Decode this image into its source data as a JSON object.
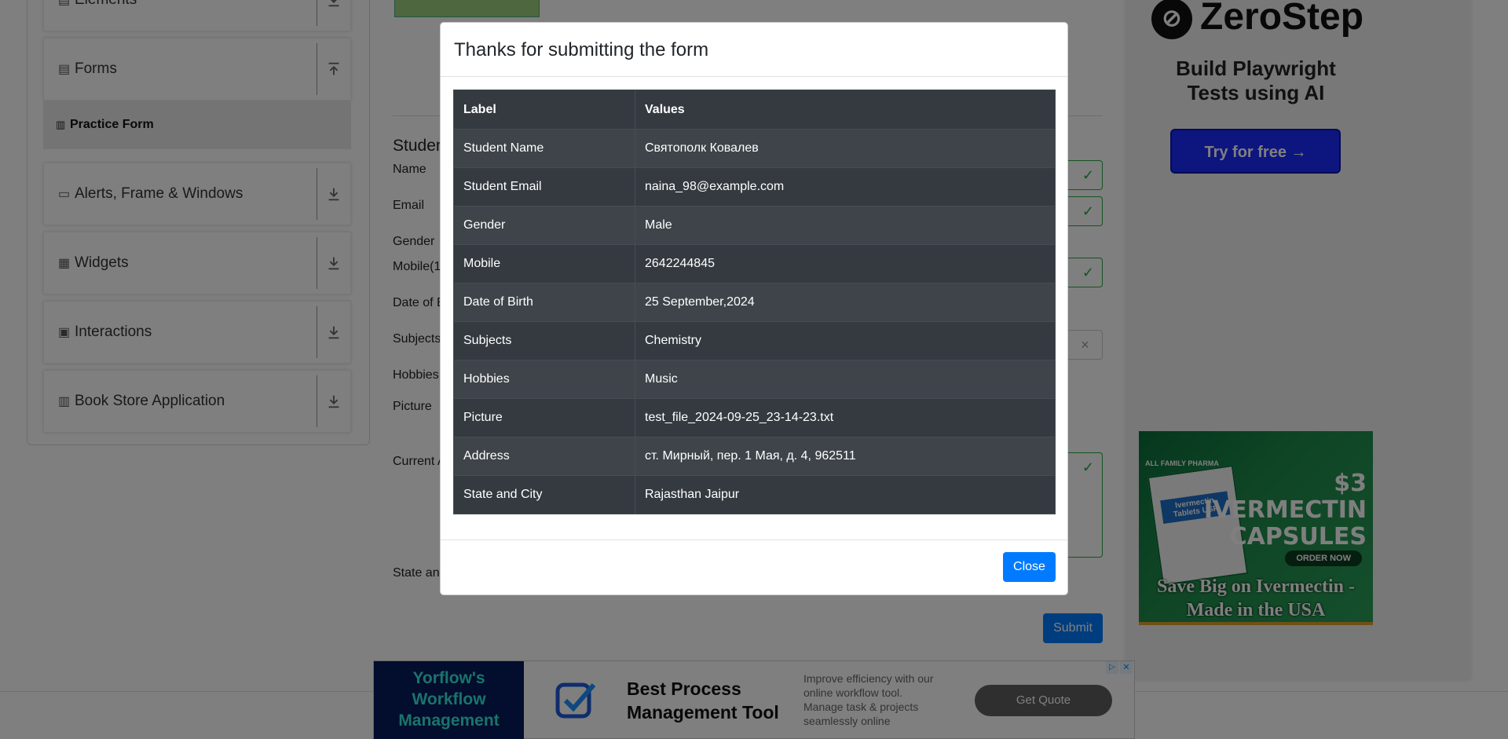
{
  "sidebar": {
    "groups": [
      {
        "label": "Elements",
        "icon": "document-icon"
      },
      {
        "label": "Forms",
        "icon": "form-icon"
      },
      {
        "label": "Alerts, Frame & Windows",
        "icon": "window-icon"
      },
      {
        "label": "Widgets",
        "icon": "widgets-icon"
      },
      {
        "label": "Interactions",
        "icon": "interactions-icon"
      },
      {
        "label": "Book Store Application",
        "icon": "bookstore-icon"
      }
    ],
    "active_item": "Practice Form"
  },
  "form": {
    "title": "Studen",
    "labels": {
      "name": "Name",
      "email": "Email",
      "gender": "Gender",
      "mobile": "Mobile(1",
      "dob": "Date of B",
      "subjects": "Subjects",
      "hobbies": "Hobbies",
      "picture": "Picture",
      "address": "Current A",
      "state": "State an"
    },
    "submit_label": "Submit"
  },
  "ads": {
    "zerostep": {
      "logo_text": "ZeroStep",
      "headline": "Build Playwright Tests using AI",
      "button": "Try for free →"
    },
    "ivermectin": {
      "brand": "ALL FAMILY PHARMA",
      "box_label": "Ivermectin Tablets USP",
      "price": "$3",
      "price_line2": "IVERMECTIN",
      "price_line3": "CAPSULES",
      "order": "ORDER NOW",
      "caption": "Save Big on Ivermectin - Made in the USA"
    },
    "bottom_banner": {
      "left_text": "Yorflow's Workflow Management",
      "title": "Best Process Management Tool",
      "description": "Improve efficiency with our online workflow tool. Manage task & projects seamlessly online",
      "button": "Get Quote",
      "adchoices": "▷",
      "close": "✕"
    }
  },
  "modal": {
    "title": "Thanks for submitting the form",
    "columns": [
      "Label",
      "Values"
    ],
    "rows": [
      {
        "label": "Student Name",
        "value": "Святополк Ковалев"
      },
      {
        "label": "Student Email",
        "value": "naina_98@example.com"
      },
      {
        "label": "Gender",
        "value": "Male"
      },
      {
        "label": "Mobile",
        "value": "2642244845"
      },
      {
        "label": "Date of Birth",
        "value": "25 September,2024"
      },
      {
        "label": "Subjects",
        "value": "Chemistry"
      },
      {
        "label": "Hobbies",
        "value": "Music"
      },
      {
        "label": "Picture",
        "value": "test_file_2024-09-25_23-14-23.txt"
      },
      {
        "label": "Address",
        "value": "ст. Мирный, пер. 1 Мая, д. 4, 962511"
      },
      {
        "label": "State and City",
        "value": "Rajasthan Jaipur"
      }
    ],
    "close_label": "Close"
  }
}
